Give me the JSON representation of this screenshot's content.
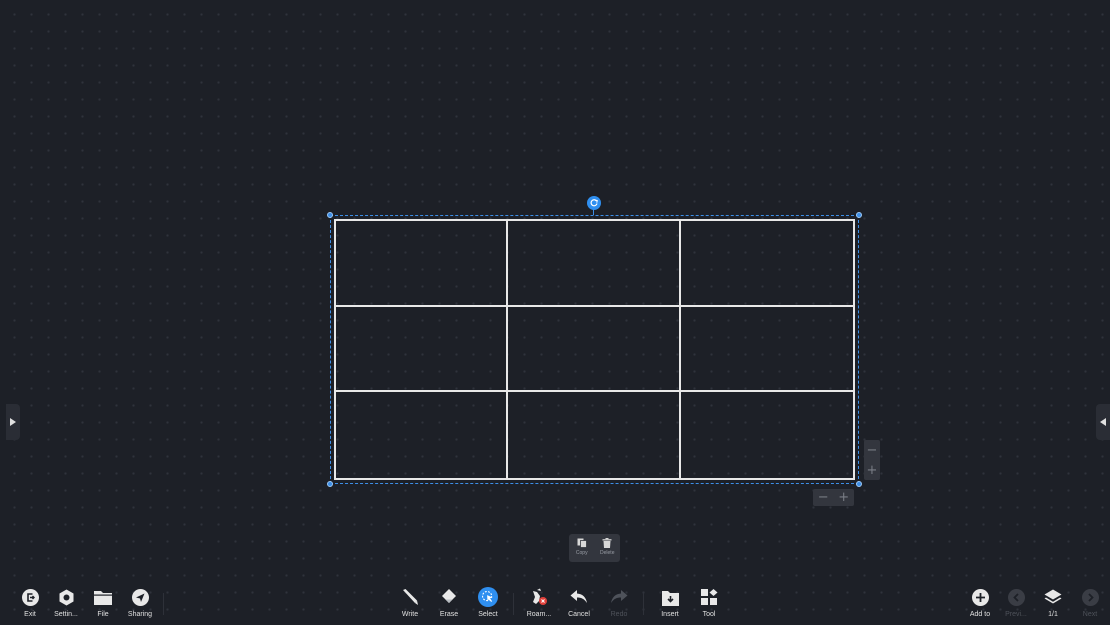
{
  "colors": {
    "background": "#1d2027",
    "accent": "#2f8ff0",
    "table_line": "#e8e8e8",
    "disabled": "#4e525a"
  },
  "table": {
    "rows": 3,
    "columns": 3
  },
  "context_menu": {
    "copy": "Copy",
    "delete": "Delete"
  },
  "steppers": {
    "minus": "−",
    "plus": "+"
  },
  "toolbar": {
    "left": [
      {
        "label": "Exit",
        "icon": "exit-icon"
      },
      {
        "label": "Settin...",
        "icon": "settings-hexagon-icon"
      },
      {
        "label": "File",
        "icon": "folder-icon"
      },
      {
        "label": "Sharing",
        "icon": "share-arrow-icon"
      }
    ],
    "center": [
      {
        "label": "Write",
        "icon": "pen-icon"
      },
      {
        "label": "Erase",
        "icon": "eraser-icon"
      },
      {
        "label": "Select",
        "icon": "select-cursor-icon",
        "active": true
      },
      {
        "label": "Roam...",
        "icon": "roam-icon"
      },
      {
        "label": "Cancel",
        "icon": "undo-icon"
      },
      {
        "label": "Redo",
        "icon": "redo-icon",
        "disabled": true
      },
      {
        "label": "Insert",
        "icon": "insert-icon"
      },
      {
        "label": "Tool",
        "icon": "tool-grid-icon"
      }
    ],
    "right": [
      {
        "label": "Add to",
        "icon": "add-circle-icon"
      },
      {
        "label": "Previ...",
        "icon": "previous-icon",
        "disabled": true
      },
      {
        "label": "1/1",
        "icon": "layers-icon"
      },
      {
        "label": "Next",
        "icon": "next-icon",
        "disabled": true
      }
    ]
  }
}
